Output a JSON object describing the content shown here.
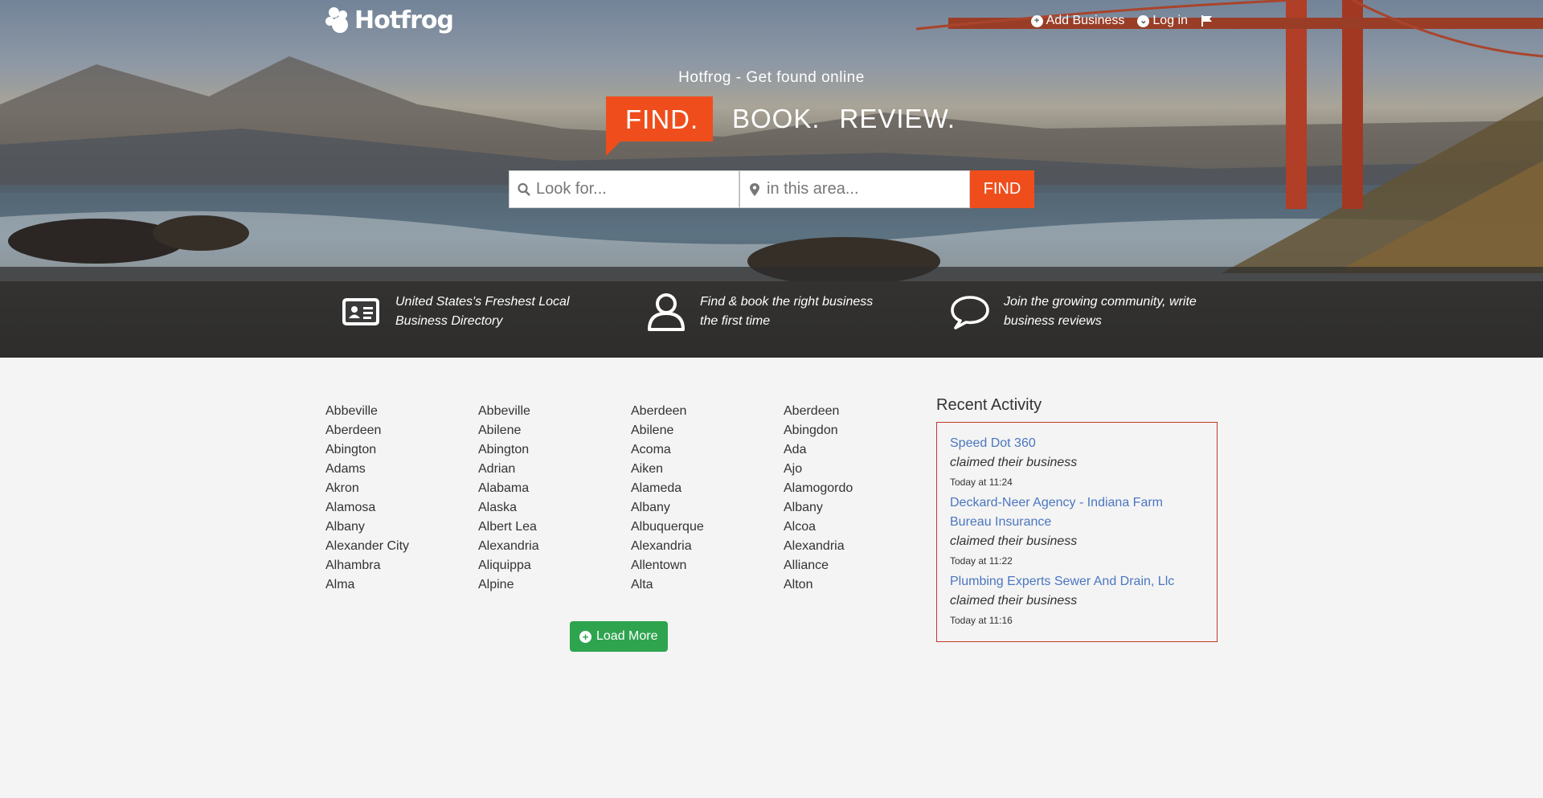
{
  "header": {
    "logo_text": "Hotfrog",
    "nav": {
      "add_business": "Add Business",
      "login": "Log in"
    }
  },
  "hero": {
    "tagline": "Hotfrog - Get found online",
    "slogan": [
      "FIND.",
      "BOOK.",
      "REVIEW."
    ]
  },
  "search": {
    "look_for_placeholder": "Look for...",
    "area_placeholder": "in this area...",
    "button_label": "FIND"
  },
  "features": [
    {
      "icon": "id-card-icon",
      "text": "United States's Freshest Local Business Directory"
    },
    {
      "icon": "user-icon",
      "text": "Find & book the right business the first time"
    },
    {
      "icon": "speech-bubble-icon",
      "text": "Join the growing community, write business reviews"
    }
  ],
  "cities": [
    [
      "Abbeville",
      "Aberdeen",
      "Abington",
      "Adams",
      "Akron",
      "Alamosa",
      "Albany",
      "Alexander City",
      "Alhambra",
      "Alma"
    ],
    [
      "Abbeville",
      "Abilene",
      "Abington",
      "Adrian",
      "Alabama",
      "Alaska",
      "Albert Lea",
      "Alexandria",
      "Aliquippa",
      "Alpine"
    ],
    [
      "Aberdeen",
      "Abilene",
      "Acoma",
      "Aiken",
      "Alameda",
      "Albany",
      "Albuquerque",
      "Alexandria",
      "Allentown",
      "Alta"
    ],
    [
      "Aberdeen",
      "Abingdon",
      "Ada",
      "Ajo",
      "Alamogordo",
      "Albany",
      "Alcoa",
      "Alexandria",
      "Alliance",
      "Alton"
    ]
  ],
  "load_more_label": "Load More",
  "recent_activity": {
    "title": "Recent Activity",
    "items": [
      {
        "business": "Speed Dot 360",
        "action": "claimed their business",
        "time": "Today at 11:24"
      },
      {
        "business": "Deckard-Neer Agency - Indiana Farm Bureau Insurance",
        "action": "claimed their business",
        "time": "Today at 11:22"
      },
      {
        "business": "Plumbing Experts Sewer And Drain, Llc",
        "action": "claimed their business",
        "time": "Today at 11:16"
      }
    ]
  },
  "colors": {
    "brand_orange": "#ef4e1c",
    "load_more_green": "#2ea44f",
    "link_blue": "#4a76c0",
    "recent_border": "#c0392b"
  }
}
